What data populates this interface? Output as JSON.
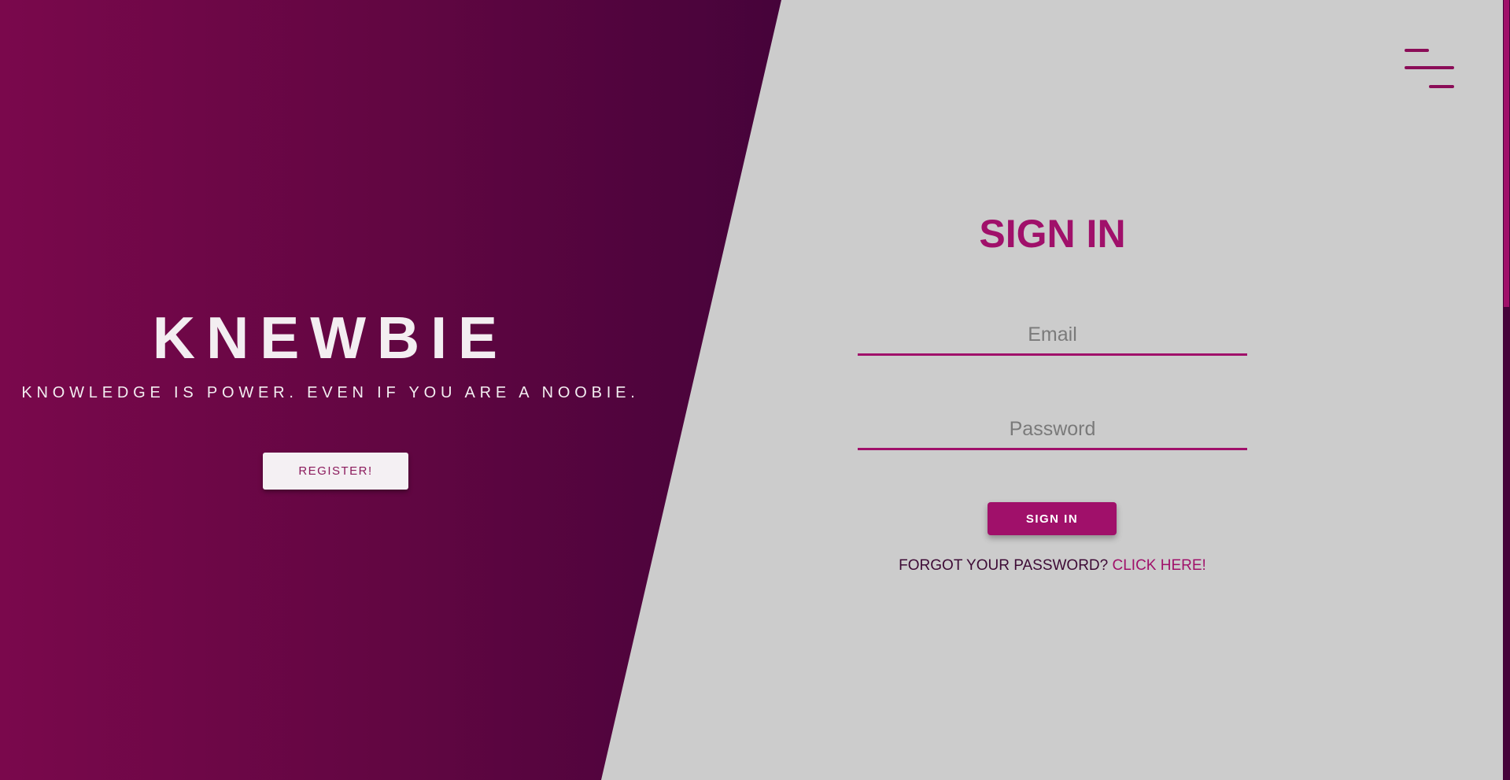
{
  "colors": {
    "brand": "#a0106a",
    "hero_gradient_start": "#7a084c",
    "hero_gradient_end": "#46033a",
    "background": "#cccccc",
    "hero_text": "#f3eef1"
  },
  "hero": {
    "title": "KNEWBIE",
    "tagline": "KNOWLEDGE IS POWER. EVEN IF YOU ARE A NOOBIE.",
    "register_label": "REGISTER!"
  },
  "nav": {
    "menu_icon": "menu-icon"
  },
  "signin": {
    "title": "SIGN IN",
    "email_placeholder": "Email",
    "password_placeholder": "Password",
    "button_label": "SIGN IN",
    "forgot_text": "FORGOT YOUR PASSWORD?",
    "forgot_link": "CLICK HERE!"
  }
}
